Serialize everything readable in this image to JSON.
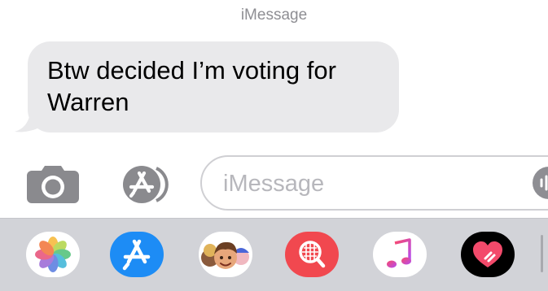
{
  "conversation": {
    "service_label": "iMessage",
    "messages": [
      {
        "direction": "received",
        "text": "Btw decided I’m voting for Warren"
      }
    ]
  },
  "composer": {
    "camera_icon": "camera-icon",
    "apps_icon": "app-store-icon",
    "input_placeholder": "iMessage",
    "input_value": "",
    "audio_icon": "audio-input-icon"
  },
  "app_drawer": {
    "apps": [
      {
        "name": "Photos",
        "icon": "photos-icon"
      },
      {
        "name": "App Store",
        "icon": "app-store-icon"
      },
      {
        "name": "Memoji",
        "icon": "memoji-icon"
      },
      {
        "name": "Search Images",
        "icon": "image-search-icon"
      },
      {
        "name": "Music",
        "icon": "music-icon"
      },
      {
        "name": "Digital Touch",
        "icon": "digital-touch-icon"
      }
    ]
  },
  "colors": {
    "received_bubble": "#e9e9eb",
    "app_store_blue": "#1d8cf5",
    "search_red": "#f1484f",
    "drawer_bg": "#d2d3d8"
  }
}
